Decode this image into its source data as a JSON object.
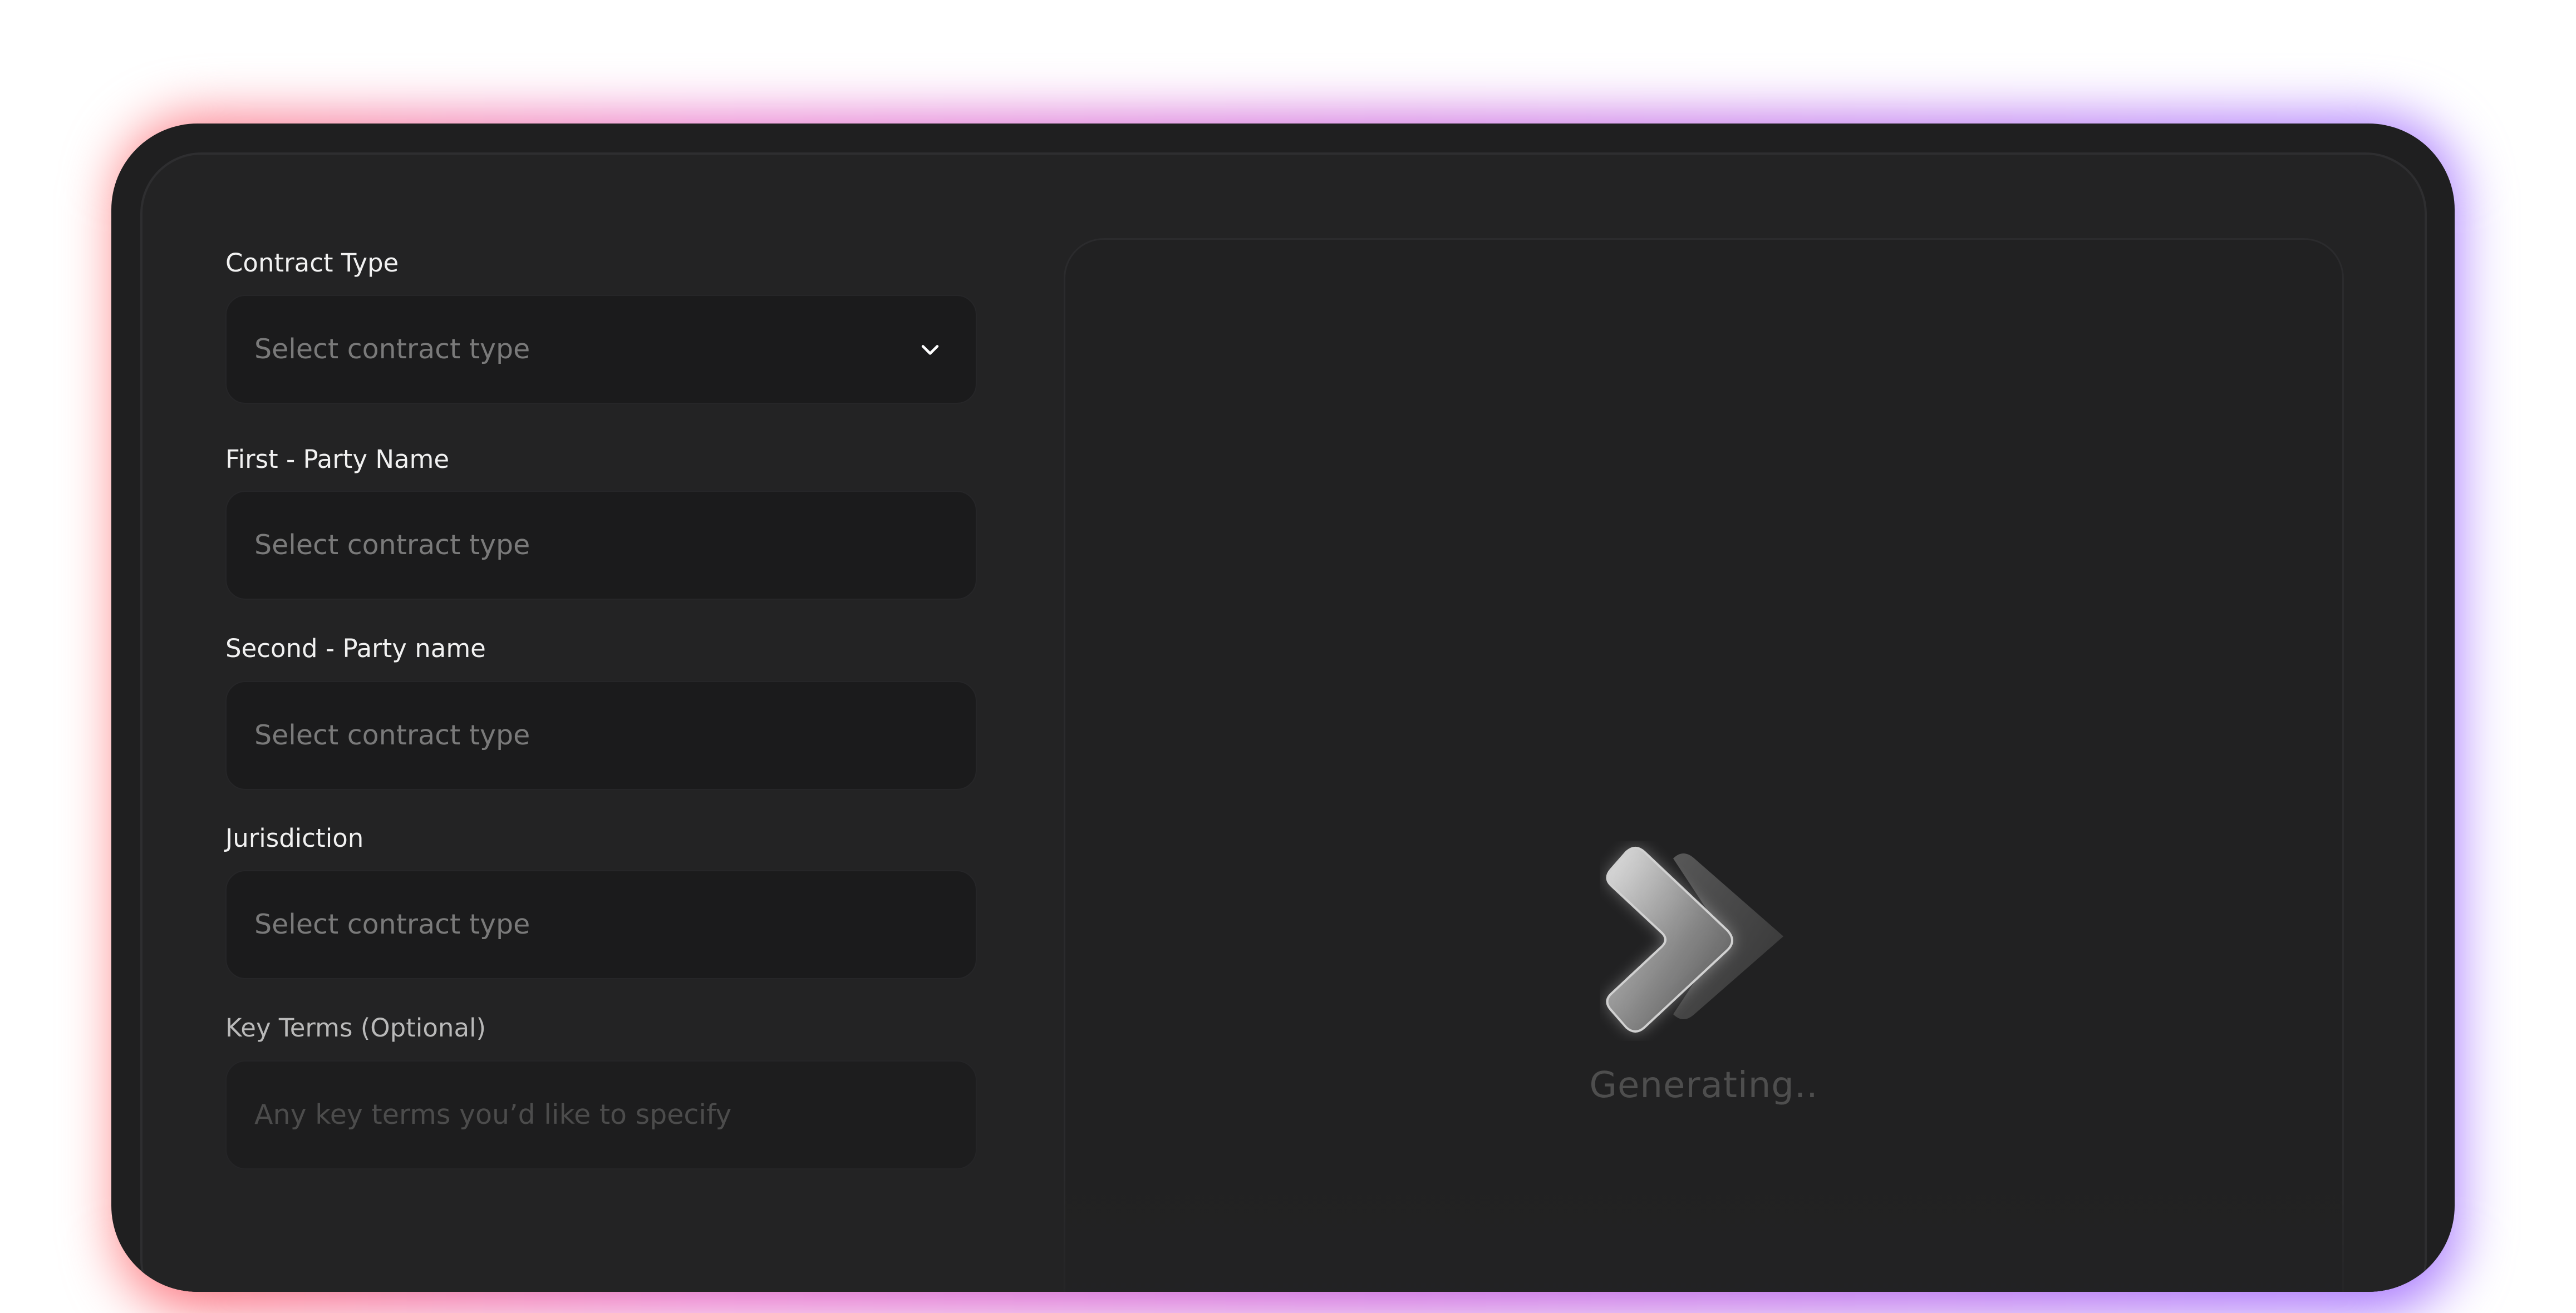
{
  "form": {
    "contract_type": {
      "label": "Contract Type",
      "placeholder": "Select contract type"
    },
    "first_party": {
      "label": "First - Party Name",
      "placeholder": "Select contract type"
    },
    "second_party": {
      "label": "Second - Party name",
      "placeholder": "Select contract type"
    },
    "jurisdiction": {
      "label": "Jurisdiction",
      "placeholder": "Select contract type"
    },
    "key_terms": {
      "label": "Key Terms (Optional)",
      "placeholder": "Any key terms you’d like to specify"
    }
  },
  "preview": {
    "status": "Generating..",
    "logo_icon": "double-chevron-logo-icon"
  },
  "icons": {
    "dropdown": "chevron-down-icon"
  },
  "colors": {
    "glow_left": "#ff7f7f",
    "glow_mid": "#cc66dd",
    "glow_right": "#a77aff",
    "panel": "#232324",
    "field": "#1b1b1c",
    "text": "#f1f1f1",
    "placeholder": "#7a7a7a"
  }
}
